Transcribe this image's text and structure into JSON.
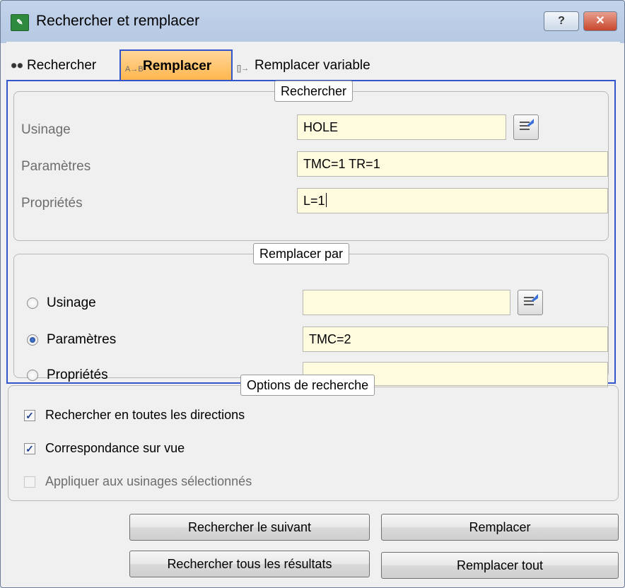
{
  "window": {
    "title": "Rechercher et remplacer",
    "help_label": "?",
    "close_label": "✕"
  },
  "tabs": [
    {
      "label": "Rechercher",
      "active": false
    },
    {
      "label": "Remplacer",
      "active": true
    },
    {
      "label": "Remplacer variable",
      "active": false
    }
  ],
  "search_group": {
    "legend": "Rechercher",
    "rows": [
      {
        "label": "Usinage",
        "value": "HOLE"
      },
      {
        "label": "Paramètres",
        "value": "TMC=1 TR=1"
      },
      {
        "label": "Propriétés",
        "value": "L=1"
      }
    ]
  },
  "replace_group": {
    "legend": "Remplacer par",
    "rows": [
      {
        "label": "Usinage",
        "value": "",
        "selected": false
      },
      {
        "label": "Paramètres",
        "value": "TMC=2",
        "selected": true
      },
      {
        "label": "Propriétés",
        "value": "",
        "selected": false
      }
    ]
  },
  "options_group": {
    "legend": "Options de recherche",
    "items": [
      {
        "label": "Rechercher en toutes les directions",
        "checked": true,
        "enabled": true
      },
      {
        "label": "Correspondance sur vue",
        "checked": true,
        "enabled": true
      },
      {
        "label": "Appliquer aux usinages sélectionnés",
        "checked": false,
        "enabled": false
      }
    ]
  },
  "buttons": {
    "find_next": "Rechercher le suivant",
    "replace": "Remplacer",
    "find_all": "Rechercher tous les résultats",
    "replace_all": "Remplacer tout"
  },
  "colors": {
    "active_tab": "#ffb54c",
    "tab_border": "#3355cc",
    "field_bg": "#fffbde",
    "close_button": "#c8452c"
  },
  "icons": [
    "app-icon",
    "help-icon",
    "close-icon",
    "binoculars-icon",
    "replace-ab-icon",
    "replace-variable-icon",
    "picker-icon"
  ]
}
